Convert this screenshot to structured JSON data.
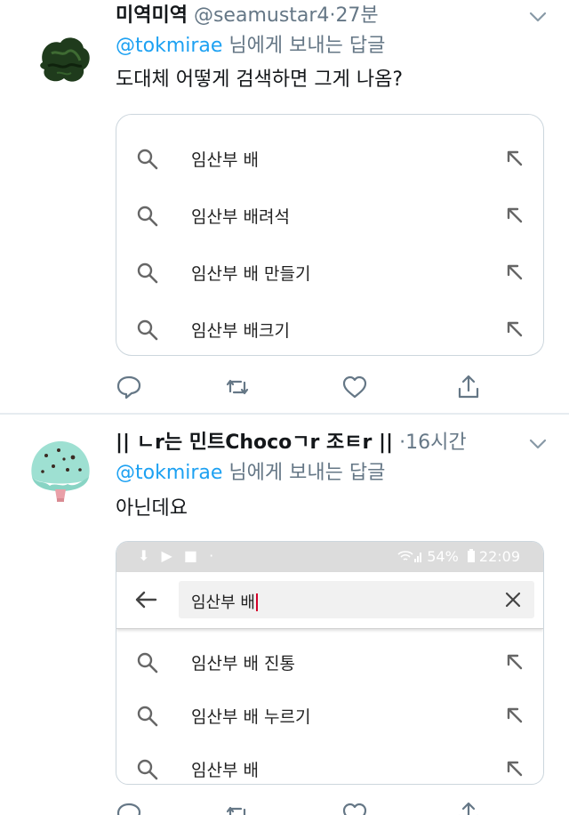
{
  "tweets": [
    {
      "name": "미역미역",
      "handle": "@seamustar4",
      "time": "27분",
      "reply_mention": "@tokmirae",
      "reply_suffix": " 님에게 보내는 답글",
      "text": "도대체 어떻게 검색하면 그게 나옴?",
      "suggestions": [
        "임산부 배",
        "임산부 배려석",
        "임산부 배 만들기",
        "임산부 배크기"
      ]
    },
    {
      "name": "|| ㄴr는 민트Chocoㄱr 조ㅌr ||",
      "handle": "",
      "time": "16시간",
      "reply_mention": "@tokmirae",
      "reply_suffix": " 님에게 보내는 답글",
      "text": "아닌데요",
      "status_bar": {
        "left_icons": "⬇ ▶ ■ ·",
        "battery": "54%",
        "clock": "22:09"
      },
      "query": "임산부 배",
      "suggestions": [
        "임산부 배 진통",
        "임산부 배 누르기",
        "임산부 배"
      ]
    }
  ],
  "separator": "·",
  "icons": {
    "avatar1": "seaweed-avatar",
    "avatar2": "mint-choco-icecream-avatar",
    "reply": "reply-icon",
    "retweet": "retweet-icon",
    "like": "heart-icon",
    "share": "share-icon"
  },
  "colors": {
    "link": "#1da1f2",
    "muted": "#657786",
    "caret": "#d4002a"
  }
}
